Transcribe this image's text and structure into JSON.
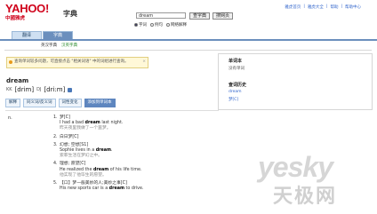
{
  "header": {
    "logo": "YAHOO!",
    "logo_sub": "中國雅虎",
    "title": "字典",
    "search_value": "dream",
    "btn_lookup": "查字典",
    "btn_web": "搜网页",
    "radios": [
      "字词",
      "例句",
      "网络解释"
    ],
    "top_links": [
      "雅虎首页",
      "雅虎大全",
      "帮助",
      "帮助中心"
    ]
  },
  "tabs": [
    "翻译",
    "字典"
  ],
  "subnav": {
    "label": "英汉字典",
    "link": "汉英字典"
  },
  "notice": {
    "text": "查询单词较多问题，可直接点击 \"相关词语\" 中的词组进行查询。"
  },
  "entry": {
    "word": "dream",
    "kk_label": "KK",
    "kk_ipa": "[drim]",
    "dj_label": "DJ",
    "dj_ipa": "[dri:m]",
    "actions": [
      "解释",
      "同义词/反义词",
      "词性变化",
      "添加到单词本"
    ],
    "pos": "n.",
    "definitions": [
      {
        "num": "1.",
        "title": "梦[C]",
        "ex_pre": "I had a bad ",
        "ex_bold": "dream",
        "ex_post": " last night.",
        "zh": "昨天夜里我做了一个噩梦。"
      },
      {
        "num": "2.",
        "title": "白日梦[C]",
        "ex_pre": "",
        "ex_bold": "",
        "ex_post": "",
        "zh": ""
      },
      {
        "num": "3.",
        "title": "幻想; 空想[S1]",
        "ex_pre": "Sophie lives in a ",
        "ex_bold": "dream",
        "ex_post": ".",
        "zh": "索菲生活在梦幻之中。"
      },
      {
        "num": "4.",
        "title": "理想; 愿望[C]",
        "ex_pre": "He realized the ",
        "ex_bold": "dream",
        "ex_post": " of his life time.",
        "zh": "他实现了他毕生的愿望。"
      },
      {
        "num": "5.",
        "title": "【口】梦一般美妙的人;美妙之事[C]",
        "ex_pre": "His new sports car is a ",
        "ex_bold": "dream",
        "ex_post": " to drive.",
        "zh": ""
      }
    ]
  },
  "right_panel": {
    "title1": "单词本",
    "text1": "没有单词",
    "title2": "查词历史",
    "link1": "dream",
    "link2": "梦[C]"
  },
  "watermark": {
    "line1": "yesky",
    "line2": "天极网"
  }
}
